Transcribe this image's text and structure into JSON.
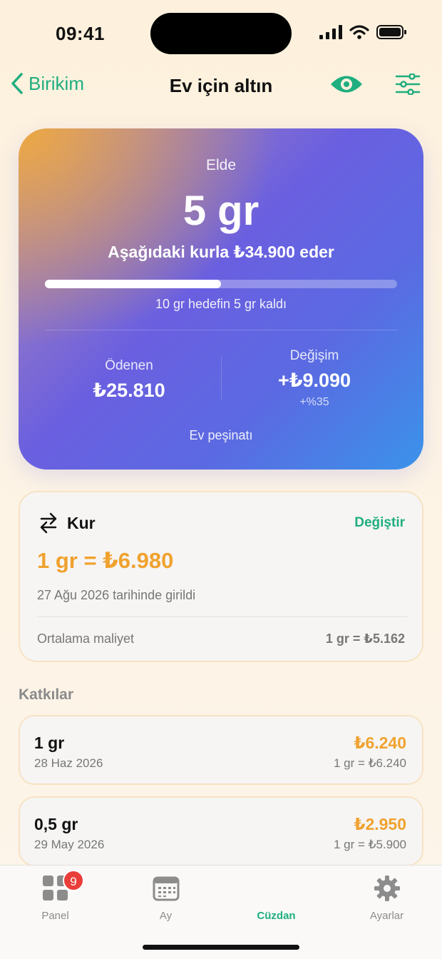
{
  "status_bar": {
    "time": "09:41"
  },
  "nav": {
    "back_label": "Birikim",
    "title": "Ev için altın"
  },
  "hero": {
    "label": "Elde",
    "amount": "5 gr",
    "worth": "Aşağıdaki kurla ₺34.900 eder",
    "progress_fraction": 0.5,
    "progress_text": "10 gr hedefin 5 gr kaldı",
    "paid_label": "Ödenen",
    "paid_value": "₺25.810",
    "change_label": "Değişim",
    "change_value": "+₺9.090",
    "change_percent": "+%35",
    "goal_name": "Ev peşinatı"
  },
  "rate": {
    "title": "Kur",
    "change_label": "Değiştir",
    "value": "1 gr = ₺6.980",
    "date": "27 Ağu 2026 tarihinde girildi",
    "avg_label": "Ortalama maliyet",
    "avg_value": "1 gr = ₺5.162"
  },
  "contributions": {
    "title": "Katkılar",
    "items": [
      {
        "amount": "1 gr",
        "date": "28 Haz 2026",
        "price": "₺6.240",
        "rate": "1 gr = ₺6.240"
      },
      {
        "amount": "0,5 gr",
        "date": "29 May 2026",
        "price": "₺2.950",
        "rate": "1 gr = ₺5.900"
      }
    ]
  },
  "tabs": [
    {
      "label": "Panel",
      "icon": "grid-icon",
      "badge": "9",
      "active": false
    },
    {
      "label": "Ay",
      "icon": "calendar-icon",
      "active": false
    },
    {
      "label": "Cüzdan",
      "icon": "wallet-icon",
      "active": true
    },
    {
      "label": "Ayarlar",
      "icon": "gear-icon",
      "active": false
    }
  ],
  "colors": {
    "accent": "#1fae7f",
    "gold": "#f0a22e",
    "badge": "#ea3e3a"
  }
}
